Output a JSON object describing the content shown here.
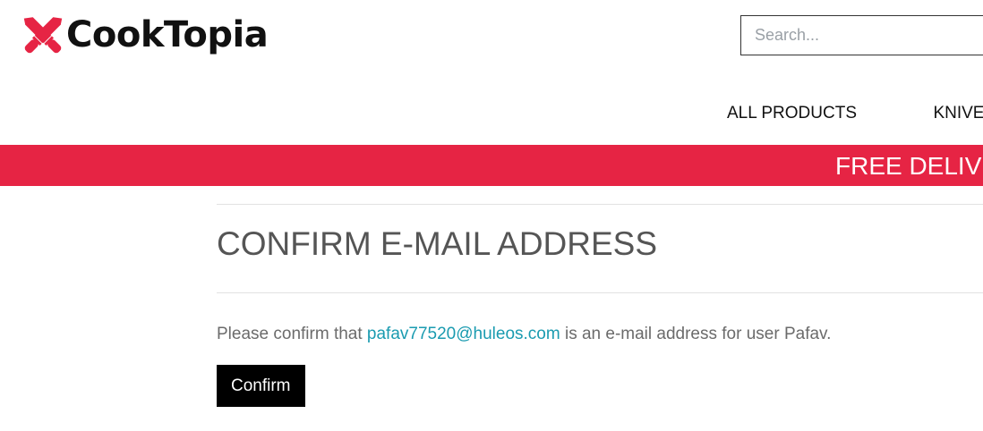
{
  "header": {
    "logo_text": "CookTopia",
    "logo_icon": "crossed-knives-icon",
    "search_placeholder": "Search..."
  },
  "nav": {
    "items": [
      {
        "label": "ALL PRODUCTS"
      },
      {
        "label": "KNIVE"
      }
    ]
  },
  "promo": {
    "text": "FREE DELIV"
  },
  "main": {
    "title": "CONFIRM E-MAIL ADDRESS",
    "message_prefix": "Please confirm that ",
    "email": "pafav77520@huleos.com",
    "message_suffix": " is an e-mail address for user Pafav.",
    "confirm_label": "Confirm"
  },
  "colors": {
    "brand_red": "#e62444",
    "link": "#1a9bb0",
    "button_bg": "#000000",
    "title_text": "#555555",
    "body_text": "#6b6b6b"
  }
}
